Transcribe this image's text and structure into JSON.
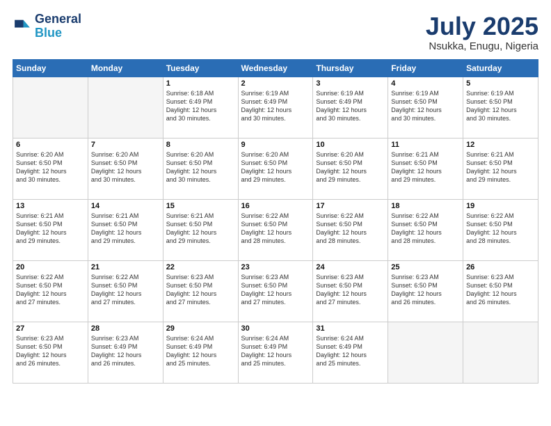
{
  "header": {
    "logo_line1": "General",
    "logo_line2": "Blue",
    "month_title": "July 2025",
    "location": "Nsukka, Enugu, Nigeria"
  },
  "day_headers": [
    "Sunday",
    "Monday",
    "Tuesday",
    "Wednesday",
    "Thursday",
    "Friday",
    "Saturday"
  ],
  "weeks": [
    [
      {
        "day": "",
        "info": "",
        "empty": true
      },
      {
        "day": "",
        "info": "",
        "empty": true
      },
      {
        "day": "1",
        "info": "Sunrise: 6:18 AM\nSunset: 6:49 PM\nDaylight: 12 hours\nand 30 minutes."
      },
      {
        "day": "2",
        "info": "Sunrise: 6:19 AM\nSunset: 6:49 PM\nDaylight: 12 hours\nand 30 minutes."
      },
      {
        "day": "3",
        "info": "Sunrise: 6:19 AM\nSunset: 6:49 PM\nDaylight: 12 hours\nand 30 minutes."
      },
      {
        "day": "4",
        "info": "Sunrise: 6:19 AM\nSunset: 6:50 PM\nDaylight: 12 hours\nand 30 minutes."
      },
      {
        "day": "5",
        "info": "Sunrise: 6:19 AM\nSunset: 6:50 PM\nDaylight: 12 hours\nand 30 minutes."
      }
    ],
    [
      {
        "day": "6",
        "info": "Sunrise: 6:20 AM\nSunset: 6:50 PM\nDaylight: 12 hours\nand 30 minutes."
      },
      {
        "day": "7",
        "info": "Sunrise: 6:20 AM\nSunset: 6:50 PM\nDaylight: 12 hours\nand 30 minutes."
      },
      {
        "day": "8",
        "info": "Sunrise: 6:20 AM\nSunset: 6:50 PM\nDaylight: 12 hours\nand 30 minutes."
      },
      {
        "day": "9",
        "info": "Sunrise: 6:20 AM\nSunset: 6:50 PM\nDaylight: 12 hours\nand 29 minutes."
      },
      {
        "day": "10",
        "info": "Sunrise: 6:20 AM\nSunset: 6:50 PM\nDaylight: 12 hours\nand 29 minutes."
      },
      {
        "day": "11",
        "info": "Sunrise: 6:21 AM\nSunset: 6:50 PM\nDaylight: 12 hours\nand 29 minutes."
      },
      {
        "day": "12",
        "info": "Sunrise: 6:21 AM\nSunset: 6:50 PM\nDaylight: 12 hours\nand 29 minutes."
      }
    ],
    [
      {
        "day": "13",
        "info": "Sunrise: 6:21 AM\nSunset: 6:50 PM\nDaylight: 12 hours\nand 29 minutes."
      },
      {
        "day": "14",
        "info": "Sunrise: 6:21 AM\nSunset: 6:50 PM\nDaylight: 12 hours\nand 29 minutes."
      },
      {
        "day": "15",
        "info": "Sunrise: 6:21 AM\nSunset: 6:50 PM\nDaylight: 12 hours\nand 29 minutes."
      },
      {
        "day": "16",
        "info": "Sunrise: 6:22 AM\nSunset: 6:50 PM\nDaylight: 12 hours\nand 28 minutes."
      },
      {
        "day": "17",
        "info": "Sunrise: 6:22 AM\nSunset: 6:50 PM\nDaylight: 12 hours\nand 28 minutes."
      },
      {
        "day": "18",
        "info": "Sunrise: 6:22 AM\nSunset: 6:50 PM\nDaylight: 12 hours\nand 28 minutes."
      },
      {
        "day": "19",
        "info": "Sunrise: 6:22 AM\nSunset: 6:50 PM\nDaylight: 12 hours\nand 28 minutes."
      }
    ],
    [
      {
        "day": "20",
        "info": "Sunrise: 6:22 AM\nSunset: 6:50 PM\nDaylight: 12 hours\nand 27 minutes."
      },
      {
        "day": "21",
        "info": "Sunrise: 6:22 AM\nSunset: 6:50 PM\nDaylight: 12 hours\nand 27 minutes."
      },
      {
        "day": "22",
        "info": "Sunrise: 6:23 AM\nSunset: 6:50 PM\nDaylight: 12 hours\nand 27 minutes."
      },
      {
        "day": "23",
        "info": "Sunrise: 6:23 AM\nSunset: 6:50 PM\nDaylight: 12 hours\nand 27 minutes."
      },
      {
        "day": "24",
        "info": "Sunrise: 6:23 AM\nSunset: 6:50 PM\nDaylight: 12 hours\nand 27 minutes."
      },
      {
        "day": "25",
        "info": "Sunrise: 6:23 AM\nSunset: 6:50 PM\nDaylight: 12 hours\nand 26 minutes."
      },
      {
        "day": "26",
        "info": "Sunrise: 6:23 AM\nSunset: 6:50 PM\nDaylight: 12 hours\nand 26 minutes."
      }
    ],
    [
      {
        "day": "27",
        "info": "Sunrise: 6:23 AM\nSunset: 6:50 PM\nDaylight: 12 hours\nand 26 minutes."
      },
      {
        "day": "28",
        "info": "Sunrise: 6:23 AM\nSunset: 6:49 PM\nDaylight: 12 hours\nand 26 minutes."
      },
      {
        "day": "29",
        "info": "Sunrise: 6:24 AM\nSunset: 6:49 PM\nDaylight: 12 hours\nand 25 minutes."
      },
      {
        "day": "30",
        "info": "Sunrise: 6:24 AM\nSunset: 6:49 PM\nDaylight: 12 hours\nand 25 minutes."
      },
      {
        "day": "31",
        "info": "Sunrise: 6:24 AM\nSunset: 6:49 PM\nDaylight: 12 hours\nand 25 minutes."
      },
      {
        "day": "",
        "info": "",
        "empty": true
      },
      {
        "day": "",
        "info": "",
        "empty": true
      }
    ]
  ]
}
